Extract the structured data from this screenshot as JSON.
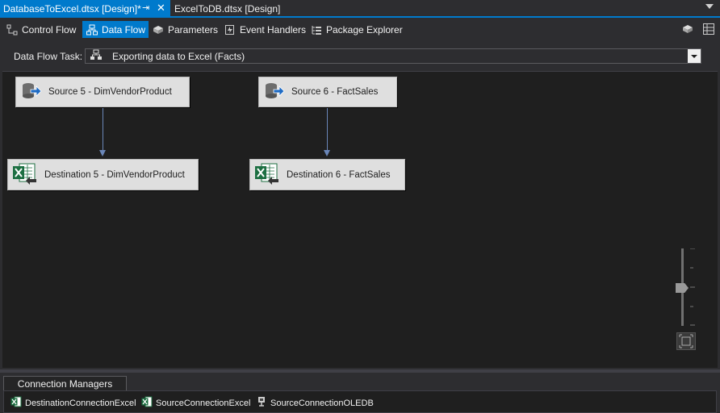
{
  "document_tabs": [
    {
      "label": "DatabaseToExcel.dtsx [Design]*",
      "active": true
    },
    {
      "label": "ExcelToDB.dtsx [Design]",
      "active": false
    }
  ],
  "designer_tabs": [
    {
      "label": "Control Flow",
      "icon": "control-flow-icon"
    },
    {
      "label": "Data Flow",
      "icon": "data-flow-icon",
      "active": true
    },
    {
      "label": "Parameters",
      "icon": "parameters-icon"
    },
    {
      "label": "Event Handlers",
      "icon": "event-handlers-icon"
    },
    {
      "label": "Package Explorer",
      "icon": "package-explorer-icon"
    }
  ],
  "task": {
    "label": "Data Flow Task:",
    "selected": "Exporting data to Excel (Facts)"
  },
  "components": [
    {
      "label": "Source 5 - DimVendorProduct",
      "kind": "source"
    },
    {
      "label": "Source 6 - FactSales",
      "kind": "source"
    },
    {
      "label": "Destination 5 - DimVendorProduct",
      "kind": "excel-destination"
    },
    {
      "label": "Destination 6 - FactSales",
      "kind": "excel-destination"
    }
  ],
  "connection_managers": {
    "title": "Connection Managers",
    "items": [
      {
        "label": "DestinationConnectionExcel",
        "icon": "excel-connection-icon"
      },
      {
        "label": "SourceConnectionExcel",
        "icon": "excel-connection-icon"
      },
      {
        "label": "SourceConnectionOLEDB",
        "icon": "oledb-connection-icon"
      }
    ]
  },
  "colors": {
    "accent": "#007acc",
    "background": "#2d2d30",
    "canvas": "#1f1f1f",
    "component": "#dfdfdf",
    "path_arrow": "#6a86b8"
  }
}
